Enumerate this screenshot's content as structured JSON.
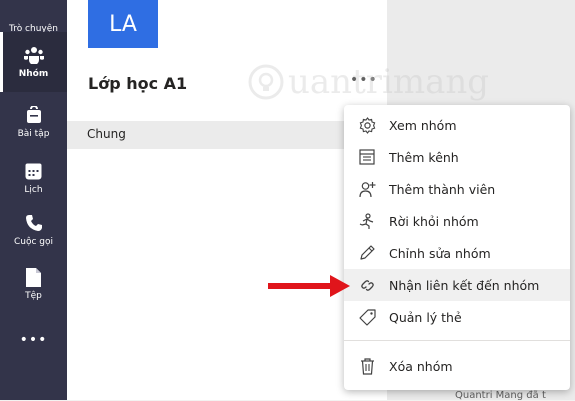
{
  "rail": {
    "items": [
      {
        "label": "Trò chuyện",
        "icon": "chat-icon"
      },
      {
        "label": "Nhóm",
        "icon": "teams-icon",
        "active": true
      },
      {
        "label": "Bài tập",
        "icon": "assignments-icon"
      },
      {
        "label": "Lịch",
        "icon": "calendar-icon"
      },
      {
        "label": "Cuộc gọi",
        "icon": "calls-icon"
      },
      {
        "label": "Tệp",
        "icon": "files-icon"
      },
      {
        "label": "•••",
        "icon": "more-apps-icon"
      }
    ]
  },
  "team": {
    "initials": "LA",
    "name": "Lớp học A1",
    "more": "•••",
    "tile_color": "#2f6ee3"
  },
  "channel": {
    "name": "Chung"
  },
  "menu": {
    "items": [
      {
        "label": "Xem nhóm",
        "icon": "gear-icon"
      },
      {
        "label": "Thêm kênh",
        "icon": "add-channel-icon"
      },
      {
        "label": "Thêm thành viên",
        "icon": "add-member-icon"
      },
      {
        "label": "Rời khỏi nhóm",
        "icon": "leave-team-icon"
      },
      {
        "label": "Chỉnh sửa nhóm",
        "icon": "pencil-icon"
      },
      {
        "label": "Nhận liên kết đến nhóm",
        "icon": "link-icon",
        "highlighted": true
      },
      {
        "label": "Quản lý thẻ",
        "icon": "tag-icon"
      },
      {
        "label": "Xóa nhóm",
        "icon": "trash-icon"
      }
    ]
  },
  "right": {
    "partial_text": "Quantri Mang đã t"
  },
  "watermark": {
    "text": "uantrimang"
  },
  "colors": {
    "rail": "#33344a",
    "arrow": "#e0151b",
    "accent": "#2f6ee3"
  }
}
